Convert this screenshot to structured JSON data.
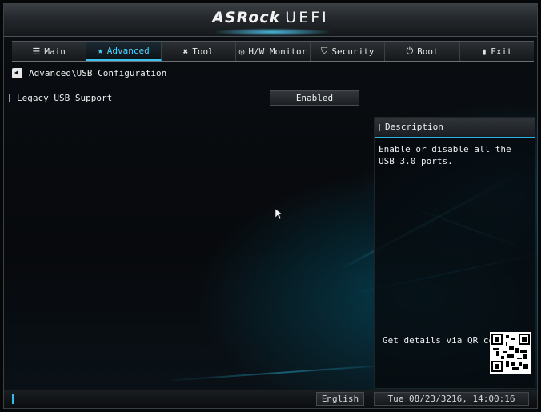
{
  "header": {
    "brand": "ASRock",
    "product": "UEFI"
  },
  "tabs": [
    {
      "label": "Main",
      "icon": "list-icon",
      "active": false
    },
    {
      "label": "Advanced",
      "icon": "star-icon",
      "active": true
    },
    {
      "label": "Tool",
      "icon": "tools-icon",
      "active": false
    },
    {
      "label": "H/W Monitor",
      "icon": "monitor-icon",
      "active": false
    },
    {
      "label": "Security",
      "icon": "shield-icon",
      "active": false
    },
    {
      "label": "Boot",
      "icon": "power-icon",
      "active": false
    },
    {
      "label": "Exit",
      "icon": "exit-icon",
      "active": false
    }
  ],
  "breadcrumb": {
    "path": "Advanced\\USB Configuration"
  },
  "settings": [
    {
      "label": "Legacy USB Support",
      "value": "Enabled"
    }
  ],
  "description": {
    "title": "Description",
    "text": "Enable or disable all the USB 3.0 ports.",
    "qr_label": "Get details via QR code"
  },
  "footer": {
    "language": "English",
    "datetime": "Tue 08/23/3216, 14:00:16"
  },
  "colors": {
    "accent": "#36b8e8",
    "background": "#07090c"
  }
}
